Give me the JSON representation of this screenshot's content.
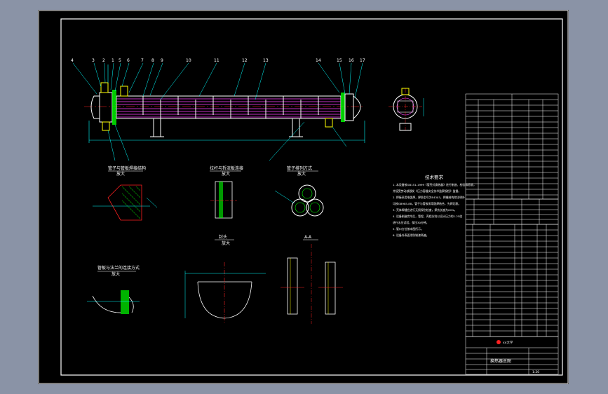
{
  "colors": {
    "background": "#000000",
    "frame": "#ffffff",
    "shell": "#ff2020",
    "tubes": "#ff40ff",
    "baffles": "#ffffff",
    "dimension": "#00ffff",
    "leader": "#00ffff",
    "center_line": "#ff2020",
    "hatch": "#00ff00",
    "nozzle": "#ffff00",
    "text": "#ffffff",
    "outer_background": "#8a93a6"
  },
  "table_logo_text": "xx大学",
  "title_block": {
    "drawing_name": "换热器总图",
    "scale": "1:20"
  },
  "main_view": {
    "part_numbers": [
      "4",
      "3",
      "2",
      "1",
      "5",
      "6",
      "7",
      "8",
      "9",
      "10",
      "11",
      "12",
      "13",
      "14",
      "15",
      "16",
      "17"
    ]
  },
  "section_titles": {
    "tube_to_tubesheet_weld": "管子与管板焊接结构",
    "baffle_rod_detail": "拉杆与折流板连接",
    "tube_layout": "管子排列方式",
    "head": "封头",
    "saddle_section": "A-A",
    "flange_to_shell": "管板与法兰的连接方式",
    "scale_note": "放大"
  },
  "technical_requirements": {
    "heading": "技术要求",
    "lines": [
      "1. 本设备按GB151-1999《管壳式换热器》进行制造、检验和验收，",
      "   并接受劳动部颁发《压力容器安全技术监察规程》监督。",
      "2. 焊接采用电弧焊，焊条型号为E4303，焊缝结构除注明外",
      "   均按GB985-88，管子与管板采用胀焊结合，先焊后胀。",
      "3. 壳体焊缝应进行无损探伤检查，探伤长度为20%。",
      "4. 设备制造完毕后，管程、壳程分别以设计压力的1.25倍",
      "   进行水压试验，保压30分钟。",
      "5. 管口方位按本图所示。",
      "6. 设备外表面涂防锈漆两遍。"
    ]
  }
}
